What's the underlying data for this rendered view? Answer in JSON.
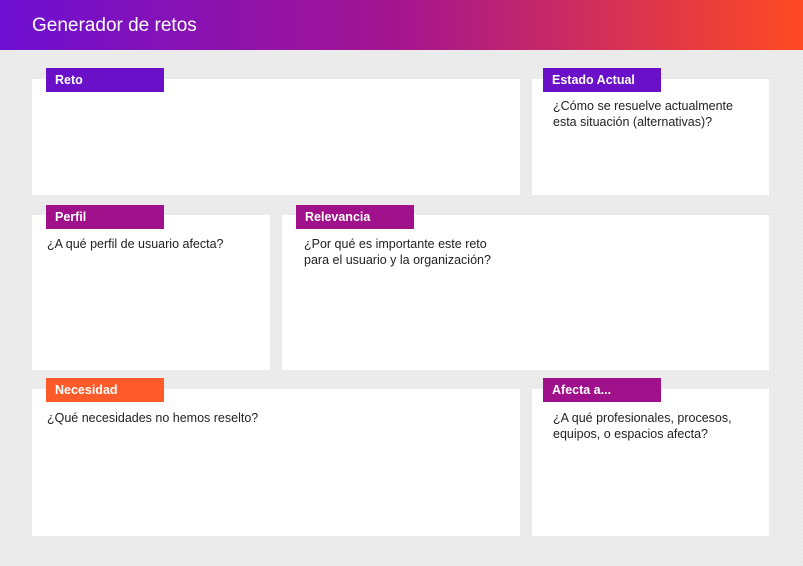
{
  "header": {
    "title": "Generador de retos"
  },
  "cards": {
    "reto": {
      "label": "Reto",
      "color": "#6a10c9",
      "lines": []
    },
    "estado_actual": {
      "label": "Estado Actual",
      "color": "#6a10c9",
      "lines": [
        "¿Cómo se resuelve actualmente",
        "esta situación (alternativas)?"
      ]
    },
    "perfil": {
      "label": "Perfil",
      "color": "#a0108a",
      "lines": [
        "¿A qué perfil de usuario afecta?"
      ]
    },
    "relevancia": {
      "label": "Relevancia",
      "color": "#a0108a",
      "lines": [
        "¿Por qué es importante este reto",
        "para el usuario y la organización?"
      ]
    },
    "necesidad": {
      "label": "Necesidad",
      "color": "#ff5a2a",
      "lines": [
        "¿Qué necesidades no hemos reselto?"
      ]
    },
    "afecta": {
      "label": "Afecta a...",
      "color": "#a0108a",
      "lines": [
        "¿A qué profesionales, procesos,",
        "equipos, o espacios afecta?"
      ]
    }
  }
}
